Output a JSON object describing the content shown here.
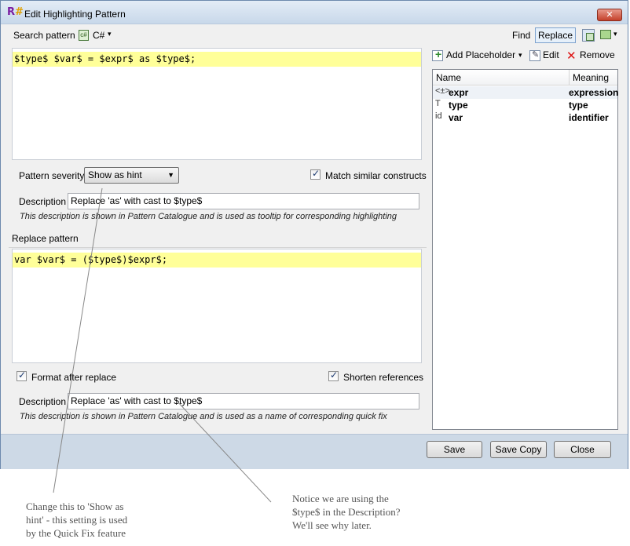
{
  "window": {
    "title": "Edit Highlighting Pattern",
    "app_icon_text": "R",
    "app_icon_accent": "#",
    "close_glyph": "✕"
  },
  "search": {
    "label": "Search pattern",
    "language": "C#",
    "language_arrow": "▾",
    "find_label": "Find",
    "replace_toggle": "Replace",
    "extra_arrow": "▾",
    "code": "$type$ $var$ = $expr$ as $type$;"
  },
  "severity": {
    "label": "Pattern severity",
    "value": "Show as hint",
    "match_similar_label": "Match similar constructs",
    "match_similar_checked": true
  },
  "search_description": {
    "label": "Description",
    "value": "Replace 'as' with cast to $type$",
    "hint": "This description is shown in Pattern Catalogue and is used as tooltip for corresponding highlighting"
  },
  "replace": {
    "header": "Replace pattern",
    "code": "var $var$ = ($type$)$expr$;",
    "format_label": "Format after replace",
    "format_checked": true,
    "shorten_label": "Shorten references",
    "shorten_checked": true
  },
  "replace_description": {
    "label": "Description",
    "value": "Replace 'as' with cast to $type$",
    "hint": "This description is shown in Pattern Catalogue and is used as a name of corresponding quick fix"
  },
  "placeholders_toolbar": {
    "add_label": "Add Placeholder",
    "add_arrow": "▾",
    "edit_label": "Edit",
    "remove_label": "Remove"
  },
  "placeholders": {
    "columns": [
      "Name",
      "Meaning"
    ],
    "rows": [
      {
        "icon": "<±>",
        "name": "expr",
        "meaning": "expression"
      },
      {
        "icon": "T",
        "name": "type",
        "meaning": "type"
      },
      {
        "icon": "id",
        "name": "var",
        "meaning": "identifier"
      }
    ]
  },
  "buttons": {
    "save": "Save",
    "save_copy": "Save Copy",
    "close": "Close"
  },
  "annotations": {
    "left_line1": "Change this to 'Show   as",
    "left_line2": "hint' - this setting is used",
    "left_line3": "by the Quick Fix feature",
    "right_line1": "Notice we are using the",
    "right_line2": "$type$ in the Description?",
    "right_line3": "We'll see why later."
  },
  "colors": {
    "code_highlight": "#ffff99",
    "footer_bg": "#cdd9e6",
    "title_gradient_top": "#e3ecf6"
  }
}
